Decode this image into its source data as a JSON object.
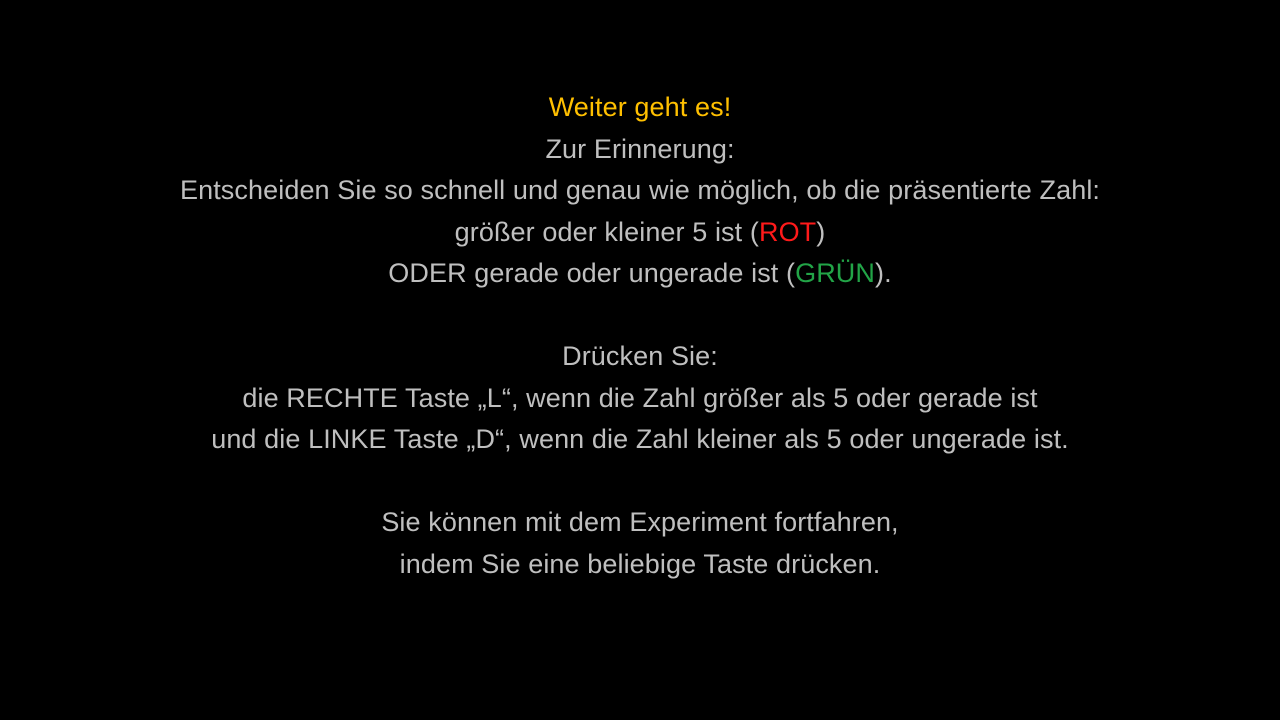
{
  "screen": {
    "title": "Weiter geht es!",
    "reminder": "Zur Erinnerung:",
    "instruction": "Entscheiden Sie so schnell und genau wie möglich, ob die präsentierte Zahl:",
    "option_red": {
      "pre": "größer oder kleiner 5 ist (",
      "key": "ROT",
      "post": ")"
    },
    "option_green": {
      "pre": "ODER gerade oder ungerade ist (",
      "key": "GRÜN",
      "post": ")."
    },
    "press_heading": "Drücken Sie:",
    "right_key_rule": "die RECHTE Taste „L“, wenn die Zahl größer als 5 oder gerade ist",
    "left_key_rule": "und die LINKE Taste „D“, wenn die Zahl kleiner als 5 oder ungerade ist.",
    "continue_line1": "Sie können mit dem Experiment fortfahren,",
    "continue_line2": "indem Sie eine beliebige Taste drücken."
  },
  "colors": {
    "background": "#000000",
    "text": "#bfbfbf",
    "title": "#ffc000",
    "red_keyword": "#ff1a1a",
    "green_keyword": "#22a447"
  }
}
